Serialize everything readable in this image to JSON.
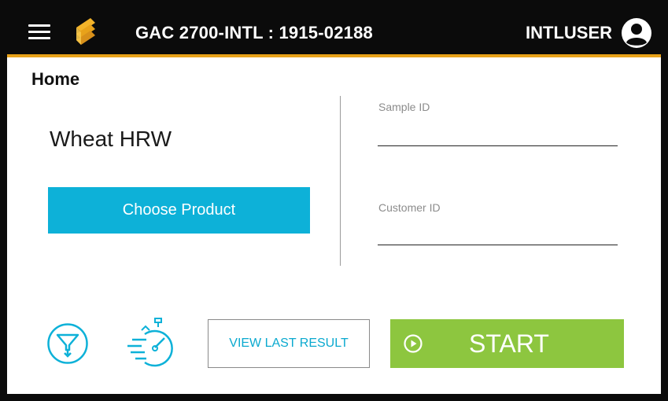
{
  "header": {
    "title": "GAC 2700-INTL : 1915-02188",
    "user": "INTLUSER",
    "menu_icon": "hamburger-menu-icon",
    "logo_icon": "dickey-john-logo-icon",
    "user_icon": "user-account-icon"
  },
  "page": {
    "title": "Home"
  },
  "product": {
    "name": "Wheat HRW",
    "choose_label": "Choose Product"
  },
  "fields": {
    "sample_id_label": "Sample ID",
    "sample_id_value": "",
    "customer_id_label": "Customer ID",
    "customer_id_value": ""
  },
  "actions": {
    "filter_icon": "funnel-filter-icon",
    "timer_icon": "stopwatch-icon",
    "view_last_label": "VIEW LAST RESULT",
    "start_label": "START",
    "start_icon": "play-circle-icon"
  },
  "colors": {
    "topbar": "#0b0b0b",
    "accent_gold": "#e8a21a",
    "primary_cyan": "#0db1d8",
    "start_green": "#8dc63f"
  }
}
